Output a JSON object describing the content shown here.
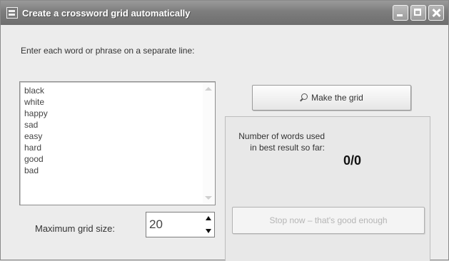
{
  "window": {
    "title": "Create a crossword grid automatically",
    "icon": "app-icon",
    "controls": [
      "minimize-icon",
      "maximize-icon",
      "close-icon"
    ]
  },
  "input": {
    "instructions": "Enter each word or phrase on a separate line:",
    "words": [
      "black",
      "white",
      "happy",
      "sad",
      "easy",
      "hard",
      "good",
      "bad"
    ]
  },
  "grid_size": {
    "label": "Maximum grid size:",
    "value": "20"
  },
  "actions": {
    "make_grid_label": "Make the grid",
    "make_grid_icon": "magnifier-icon",
    "stop_label": "Stop now – that's good enough"
  },
  "status": {
    "words_label": "Number of words used in best result so far:",
    "score": "0/0"
  }
}
